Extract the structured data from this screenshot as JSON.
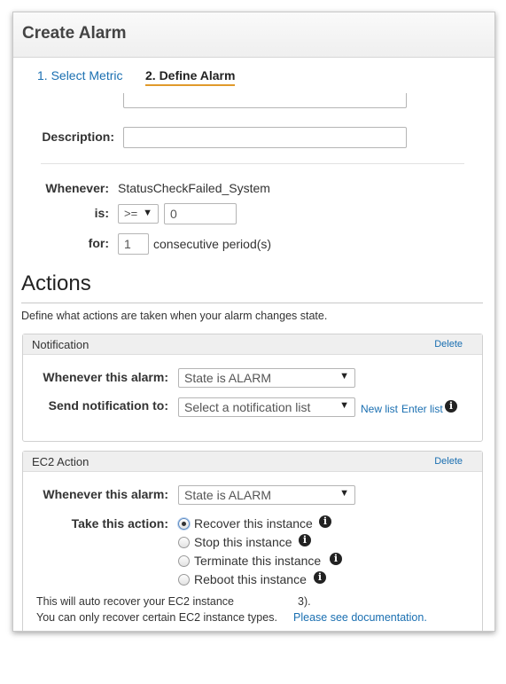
{
  "dialog": {
    "title": "Create Alarm"
  },
  "steps": [
    {
      "label": "1. Select Metric"
    },
    {
      "label": "2. Define Alarm"
    }
  ],
  "form": {
    "name_value": "",
    "description_label": "Description:",
    "description_value": "",
    "whenever_label": "Whenever:",
    "metric": "StatusCheckFailed_System",
    "is_label": "is:",
    "operator": ">=",
    "threshold": "0",
    "for_label": "for:",
    "periods": "1",
    "periods_suffix": "consecutive period(s)"
  },
  "actions": {
    "title": "Actions",
    "description": "Define what actions are taken when your alarm changes state."
  },
  "notification": {
    "title": "Notification",
    "delete": "Delete",
    "whenever_label": "Whenever this alarm:",
    "state": "State is ALARM",
    "send_label": "Send notification to:",
    "list_placeholder": "Select a notification list",
    "new_list": "New list",
    "enter_list": "Enter list"
  },
  "ec2_action": {
    "title": "EC2 Action",
    "delete": "Delete",
    "whenever_label": "Whenever this alarm:",
    "state": "State is ALARM",
    "take_label": "Take this action:",
    "options": [
      {
        "label": "Recover this instance",
        "checked": true
      },
      {
        "label": "Stop this instance",
        "checked": false
      },
      {
        "label": "Terminate this instance",
        "checked": false
      },
      {
        "label": "Reboot this instance",
        "checked": false
      }
    ],
    "note_line1_a": "This will auto recover your EC2 instance",
    "note_line1_b": "3).",
    "note_line2": "You can only recover certain EC2 instance types.",
    "doc_link": "Please see documentation."
  },
  "colors": {
    "link": "#1a6fb1",
    "step_underline": "#e09a2b"
  }
}
